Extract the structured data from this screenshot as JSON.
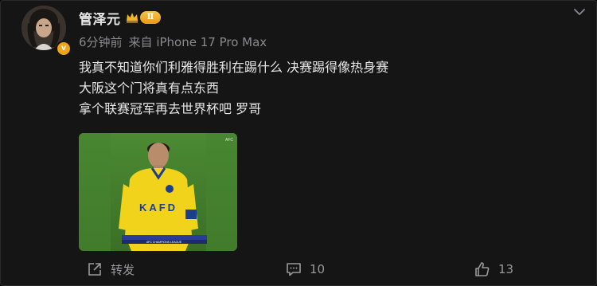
{
  "post": {
    "author": {
      "name": "管泽元",
      "level_badge": "Ⅱ",
      "verified_mark": "v"
    },
    "meta": {
      "time": "6分钟前",
      "source": "来自 iPhone 17 Pro Max"
    },
    "text_lines": [
      "我真不知道你们利雅得胜利在踢什么 决赛踢得像热身赛",
      "大阪这个门将真有点东西",
      "拿个联赛冠军再去世界杯吧 罗哥"
    ],
    "image": {
      "jersey_text": "KAFD",
      "broadcast_tag": "AFC",
      "scorebar_text": "AFC CHAMPIONS LEAGUE"
    },
    "actions": {
      "repost_label": "转发",
      "comment_count": "10",
      "like_count": "13"
    }
  },
  "icons": {
    "more": "chevron-down-icon",
    "repost": "share-out-icon",
    "comment": "comment-icon",
    "like": "thumbs-up-icon"
  },
  "colors": {
    "background": "#151516",
    "text": "#e6e6e6",
    "meta": "#8a8a8c",
    "verified": "#f0a417",
    "jersey": "#f2d31b"
  }
}
